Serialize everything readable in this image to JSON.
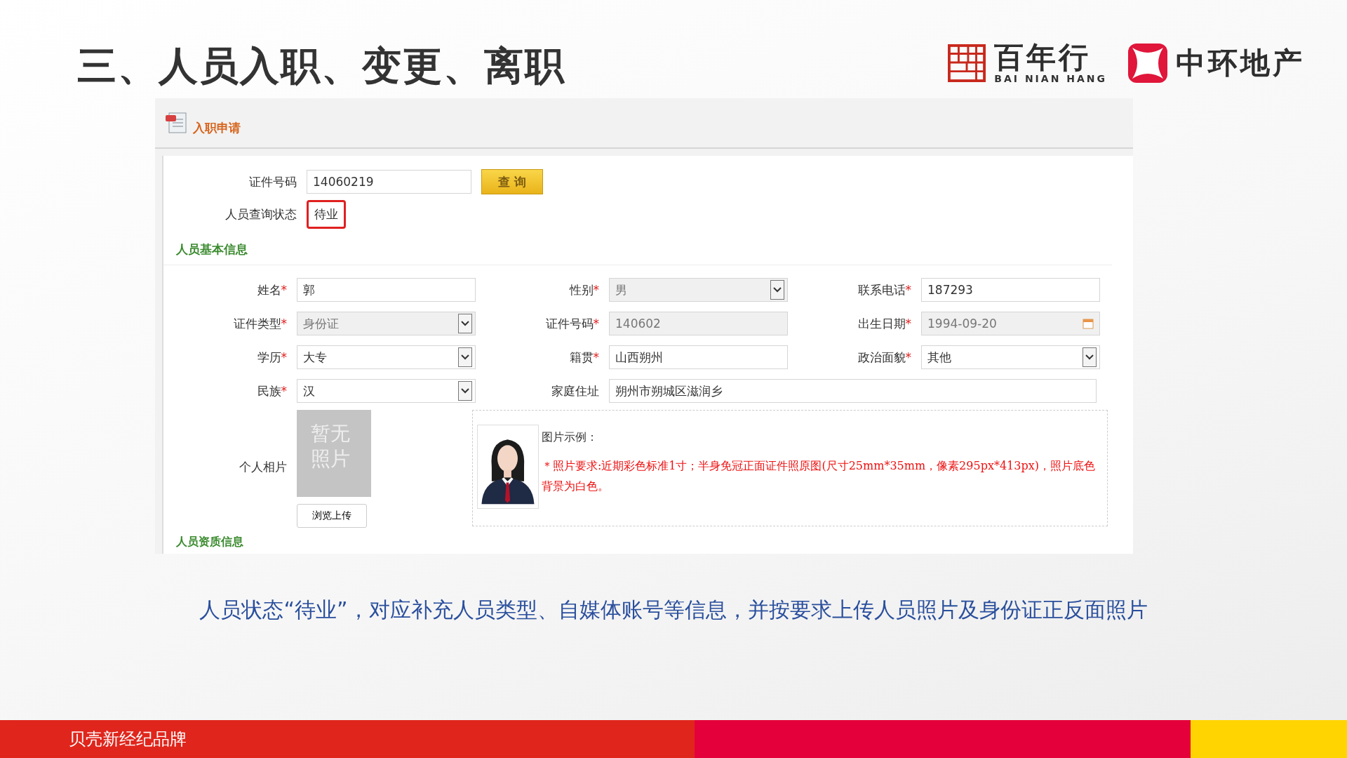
{
  "slide_title": "三、人员入职、变更、离职",
  "logos": [
    {
      "kind": "grid",
      "name": "百年行",
      "subtitle": "BAI NIAN HANG"
    },
    {
      "kind": "cross",
      "name": "中环地产"
    }
  ],
  "form": {
    "title": "入职申请",
    "id_query": {
      "label": "证件号码",
      "value": "14060219",
      "button": "查 询"
    },
    "status": {
      "label": "人员查询状态",
      "value": "待业",
      "highlighted": true
    },
    "section_title": "人员基本信息",
    "required_mark": "*",
    "fields": [
      {
        "label": "姓名",
        "value": "郭",
        "required": true,
        "kind": "text",
        "disabled": false
      },
      {
        "label": "性别",
        "value": "男",
        "required": true,
        "kind": "select",
        "disabled": true
      },
      {
        "label": "联系电话",
        "value": "187293",
        "required": true,
        "kind": "text",
        "disabled": false
      },
      {
        "label": "证件类型",
        "value": "身份证",
        "required": true,
        "kind": "select",
        "disabled": true
      },
      {
        "label": "证件号码",
        "value": "140602",
        "required": true,
        "kind": "text",
        "disabled": true
      },
      {
        "label": "出生日期",
        "value": "1994-09-20",
        "required": true,
        "kind": "date",
        "disabled": true
      },
      {
        "label": "学历",
        "value": "大专",
        "required": true,
        "kind": "select",
        "disabled": false
      },
      {
        "label": "籍贯",
        "value": "山西朔州",
        "required": true,
        "kind": "text",
        "disabled": false
      },
      {
        "label": "政治面貌",
        "value": "其他",
        "required": true,
        "kind": "select",
        "disabled": false
      },
      {
        "label": "民族",
        "value": "汉",
        "required": true,
        "kind": "select",
        "disabled": false
      },
      {
        "label": "家庭住址",
        "value": "朔州市朔城区滋润乡",
        "required": false,
        "kind": "wide",
        "disabled": false
      }
    ],
    "photo": {
      "label": "个人相片",
      "placeholder": "暂无照片",
      "upload_button": "浏览上传"
    },
    "example": {
      "label": "图片示例：",
      "note": "＊照片要求:近期彩色标准1寸；半身免冠正面证件照原图(尺寸25mm*35mm，像素295px*413px)，照片底色背景为白色。"
    },
    "next_section": "人员资质信息"
  },
  "caption": "人员状态“待业”，对应补充人员类型、自媒体账号等信息，并按要求上传人员照片及身份证正反面照片",
  "footer": {
    "brand": "贝壳新经纪品牌"
  }
}
